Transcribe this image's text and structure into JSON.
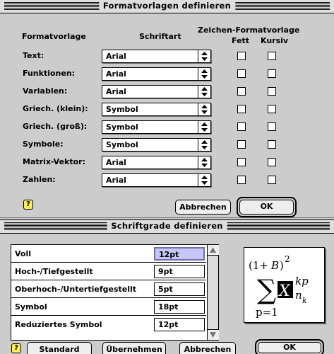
{
  "dialog1": {
    "title": "Formatvorlagen definieren",
    "headers": {
      "formatvorlage": "Formatvorlage",
      "schriftart": "Schriftart",
      "zeichen_formatvorlage": "Zeichen-Formatvorlage",
      "fett": "Fett",
      "kursiv": "Kursiv"
    },
    "rows": [
      {
        "label": "Text:",
        "font": "Arial"
      },
      {
        "label": "Funktionen:",
        "font": "Arial"
      },
      {
        "label": "Variablen:",
        "font": "Arial"
      },
      {
        "label": "Griech. (klein):",
        "font": "Symbol"
      },
      {
        "label": "Griech. (groß):",
        "font": "Symbol"
      },
      {
        "label": "Symbole:",
        "font": "Symbol"
      },
      {
        "label": "Matrix-Vektor:",
        "font": "Arial"
      },
      {
        "label": "Zahlen:",
        "font": "Arial"
      }
    ],
    "help": "?",
    "cancel_label": "Abbrechen",
    "ok_label": "OK"
  },
  "dialog2": {
    "title": "Schriftgrade definieren",
    "sizes": [
      {
        "label": "Voll",
        "value": "12pt"
      },
      {
        "label": "Hoch-/Tiefgestellt",
        "value": "9pt"
      },
      {
        "label": "Oberhoch-/Untertiefgestellt",
        "value": "5pt"
      },
      {
        "label": "Symbol",
        "value": "18pt"
      },
      {
        "label": "Reduziertes Symbol",
        "value": "12pt"
      }
    ],
    "preview": {
      "open_paren": "(1+",
      "B": "B",
      "close_paren": ")",
      "exp": "2",
      "sum": "∑",
      "X": "X",
      "sub_lower": "p=1",
      "kp": "kp",
      "n": "n",
      "k": "k"
    },
    "help": "?",
    "standard_label": "Standard",
    "apply_label": "Übernehmen",
    "cancel_label": "Abbrechen",
    "ok_label": "OK"
  }
}
